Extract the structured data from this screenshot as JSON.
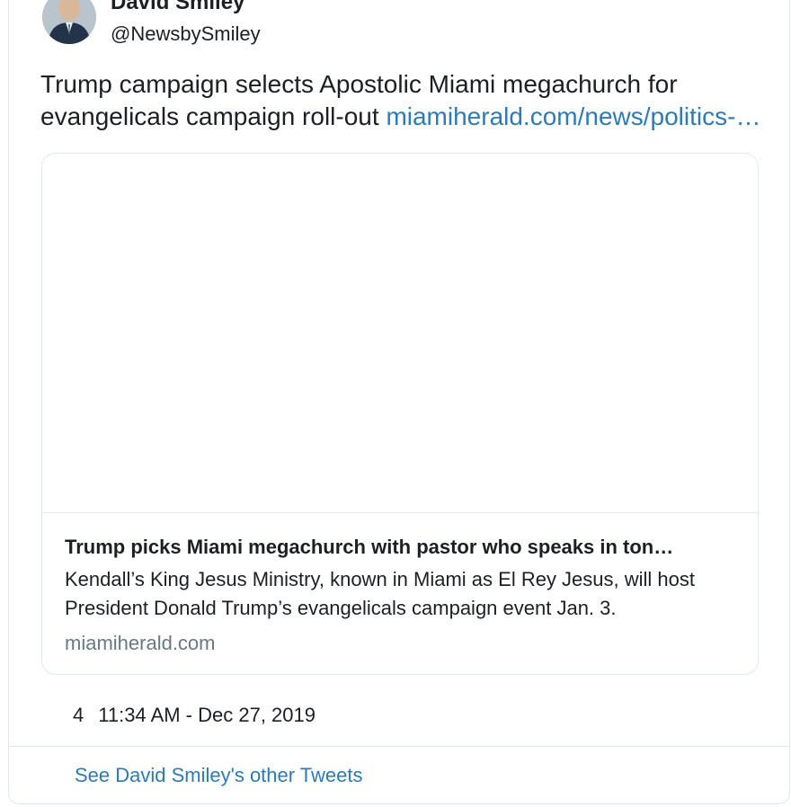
{
  "author": {
    "display_name": "David Smiley",
    "handle": "@NewsbySmiley"
  },
  "tweet": {
    "text": "Trump campaign selects Apostolic Miami megachurch for evangelicals campaign roll-out ",
    "link_text": "miamiherald.com/news/politics-…"
  },
  "card": {
    "title": "Trump picks Miami megachurch with pastor who speaks in ton…",
    "description": "Kendall’s King Jesus Ministry, known in Miami as El Rey Jesus, will host President Donald Trump’s evangelicals campaign event Jan. 3.",
    "domain": "miamiherald.com"
  },
  "meta": {
    "like_count": "4",
    "timestamp": "11:34 AM - Dec 27, 2019"
  },
  "footer": {
    "see_more_label": "See David Smiley's other Tweets"
  },
  "colors": {
    "link": "#2b7bb9",
    "border": "#e1e8ed",
    "text": "#1c2022",
    "muted": "#697882"
  }
}
